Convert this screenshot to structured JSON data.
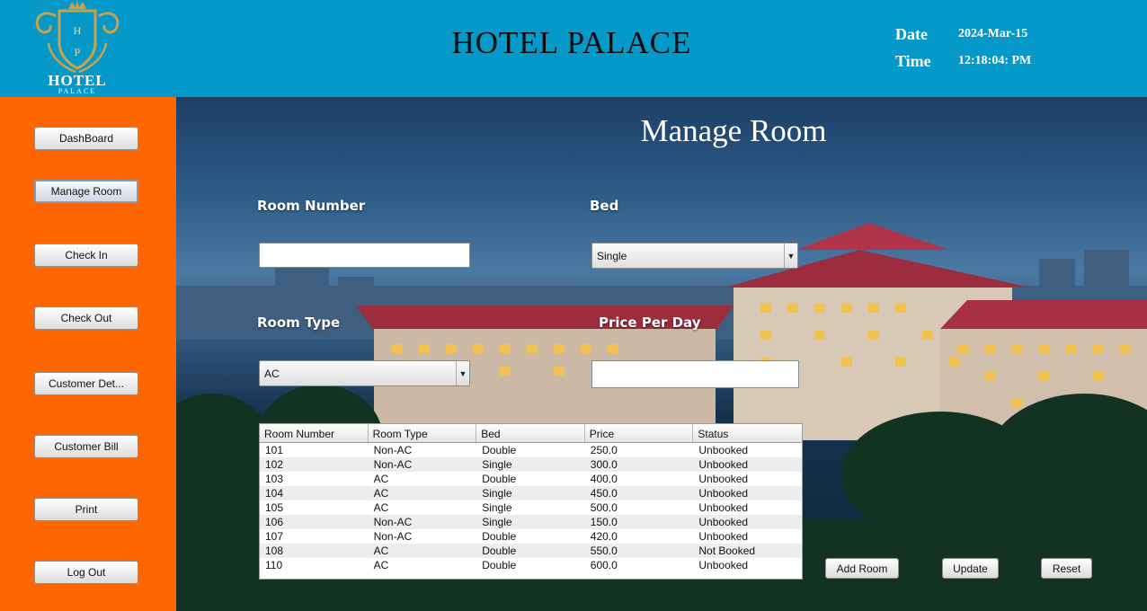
{
  "header": {
    "logo_letters": "H P",
    "logo_text": "HOTEL",
    "logo_subtext": "PALACE",
    "title": "HOTEL PALACE",
    "date_label": "Date",
    "date_value": "2024-Mar-15",
    "time_label": "Time",
    "time_value": "12:18:04: PM"
  },
  "sidebar": {
    "items": [
      {
        "label": "DashBoard"
      },
      {
        "label": "Manage Room",
        "active": true
      },
      {
        "label": "Check In"
      },
      {
        "label": "Check Out"
      },
      {
        "label": "Customer Det..."
      },
      {
        "label": "Customer Bill"
      },
      {
        "label": "Print"
      },
      {
        "label": "Log Out"
      }
    ]
  },
  "form": {
    "page_title": "Manage Room",
    "room_number_label": "Room Number",
    "room_number_value": "",
    "bed_label": "Bed",
    "bed_selected": "Single",
    "room_type_label": "Room Type",
    "room_type_selected": "AC",
    "price_label": "Price Per Day",
    "price_value": ""
  },
  "table": {
    "columns": [
      "Room Number",
      "Room Type",
      "Bed",
      "Price",
      "Status"
    ],
    "rows": [
      [
        "101",
        "Non-AC",
        "Double",
        "250.0",
        "Unbooked"
      ],
      [
        "102",
        "Non-AC",
        "Single",
        "300.0",
        "Unbooked"
      ],
      [
        "103",
        "AC",
        "Double",
        "400.0",
        "Unbooked"
      ],
      [
        "104",
        "AC",
        "Single",
        "450.0",
        "Unbooked"
      ],
      [
        "105",
        "AC",
        "Single",
        "500.0",
        "Unbooked"
      ],
      [
        "106",
        "Non-AC",
        "Single",
        "150.0",
        "Unbooked"
      ],
      [
        "107",
        "Non-AC",
        "Double",
        "420.0",
        "Unbooked"
      ],
      [
        "108",
        "AC",
        "Double",
        "550.0",
        "Not Booked"
      ],
      [
        "110",
        "AC",
        "Double",
        "600.0",
        "Unbooked"
      ]
    ]
  },
  "actions": {
    "add_label": "Add Room",
    "update_label": "Update",
    "reset_label": "Reset"
  },
  "colors": {
    "header_bg": "#0599c9",
    "sidebar_bg": "#ff6600",
    "logo_gold": "#c9a24a"
  }
}
